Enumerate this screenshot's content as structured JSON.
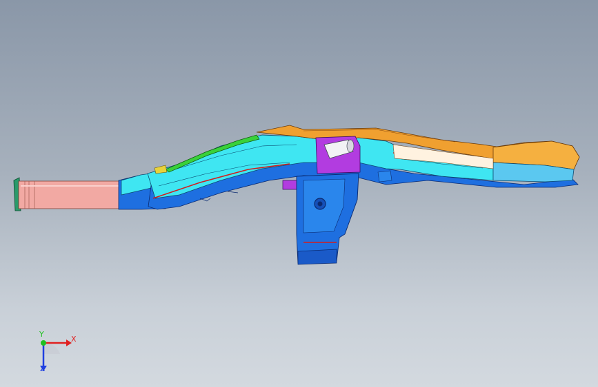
{
  "viewport": {
    "background_top": "#8a97a8",
    "background_bottom": "#d3d9df"
  },
  "model": {
    "name": "",
    "colors": {
      "pipe_pink": "#f2a9a3",
      "body_cyan": "#3fe6f2",
      "body_blue": "#1e6fe0",
      "orange": "#f0a030",
      "magenta": "#b23ce0",
      "green": "#39d13a",
      "white_part": "#f2f2f5",
      "red_edge": "#d21e1e"
    }
  },
  "triad": {
    "x_label": "X",
    "y_label": "Y",
    "z_label": "Z",
    "x_color": "#e02020",
    "y_color": "#20c020",
    "z_color": "#2040e0",
    "icon": "coordinate-triad-icon"
  }
}
